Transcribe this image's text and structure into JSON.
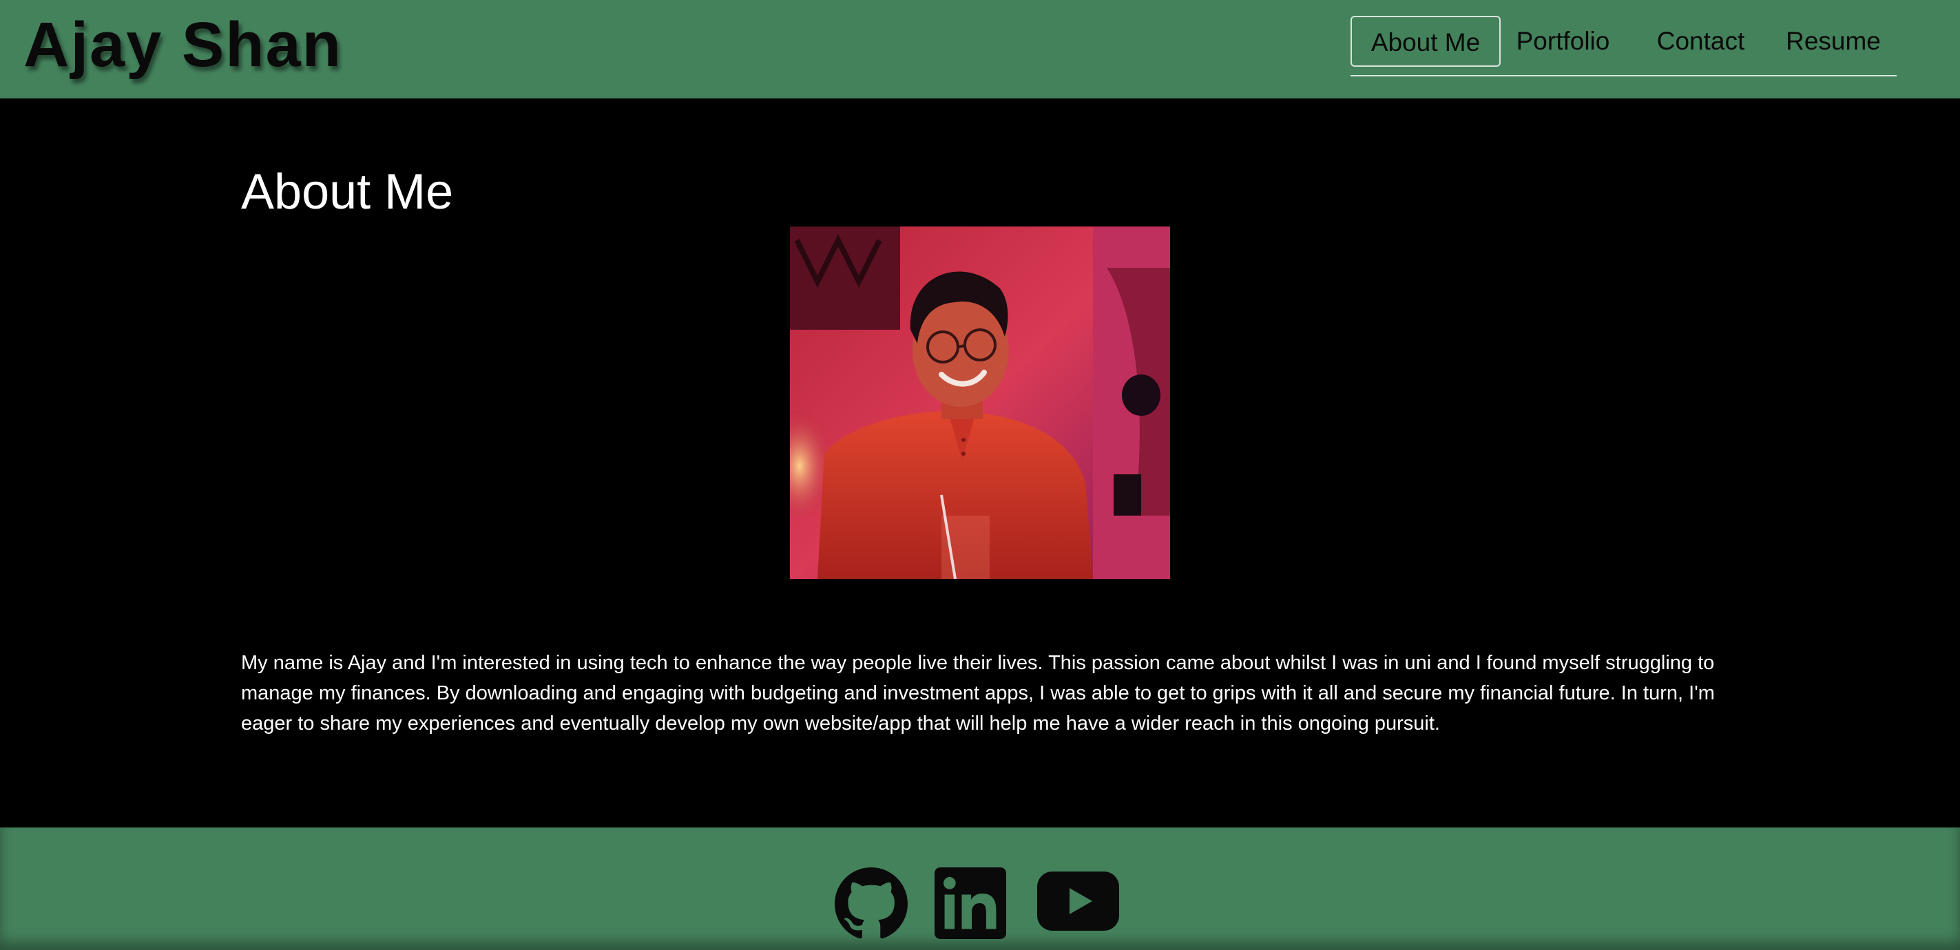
{
  "header": {
    "site_title": "Ajay Shan",
    "bg_color": "#44825c"
  },
  "nav": {
    "items": [
      {
        "label": "About Me",
        "active": true
      },
      {
        "label": "Portfolio",
        "active": false
      },
      {
        "label": "Contact",
        "active": false
      },
      {
        "label": "Resume",
        "active": false
      }
    ]
  },
  "main": {
    "heading": "About Me",
    "photo_alt": "profile photo",
    "bio": "My name is Ajay and I'm interested in using tech to enhance the way people live their lives. This passion came about whilst I was in uni and I found myself struggling to manage my finances. By downloading and engaging with budgeting and investment apps, I was able to get to grips with it all and secure my financial future. In turn, I'm eager to share my experiences and eventually develop my own website/app that will help me have a wider reach in this ongoing pursuit."
  },
  "footer": {
    "icons": [
      "github-icon",
      "linkedin-icon",
      "youtube-icon"
    ]
  }
}
